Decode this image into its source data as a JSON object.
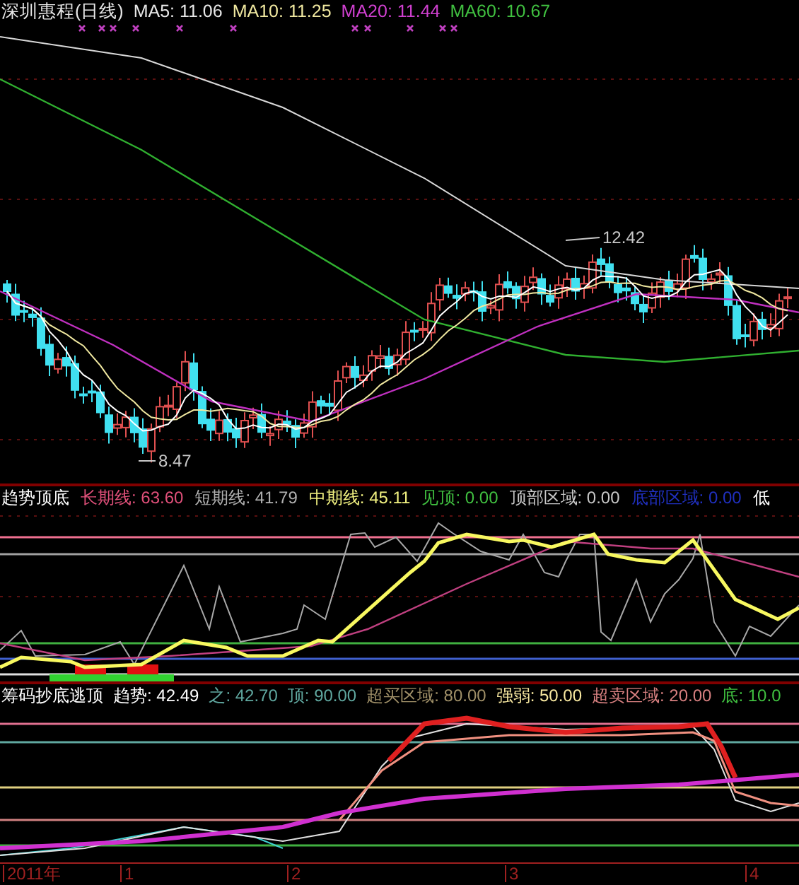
{
  "main_header": [
    {
      "text": "深圳惠程(日线)",
      "color": "#e8e8e8"
    },
    {
      "text": "MA5: 11.06",
      "color": "#e8e8e8"
    },
    {
      "text": "MA10: 11.25",
      "color": "#f0e8a0"
    },
    {
      "text": "MA20: 11.44",
      "color": "#d040d0"
    },
    {
      "text": "MA60: 10.67",
      "color": "#40c040"
    }
  ],
  "price_annotations": [
    {
      "text": "12.42",
      "kind": "high"
    },
    {
      "text": "8.47",
      "kind": "low"
    }
  ],
  "indicator_1": {
    "title": "趋势顶底",
    "items": [
      {
        "text": "长期线: 63.60",
        "color": "#e0507a"
      },
      {
        "text": "短期线: 41.79",
        "color": "#b0b0b0"
      },
      {
        "text": "中期线: 45.11",
        "color": "#f0f080"
      },
      {
        "text": "见顶: 0.00",
        "color": "#40c040"
      },
      {
        "text": "顶部区域: 0.00",
        "color": "#c8c8c8"
      },
      {
        "text": "底部区域: 0.00",
        "color": "#2030c0"
      },
      {
        "text": "低",
        "color": "#ffffff"
      }
    ]
  },
  "indicator_2": {
    "title": "筹码抄底逃顶",
    "items": [
      {
        "text": "趋势: 42.49",
        "color": "#ffffff"
      },
      {
        "text": "之: 42.70",
        "color": "#60a8a0"
      },
      {
        "text": "顶: 90.00",
        "color": "#60a8a0"
      },
      {
        "text": "超买区域: 80.00",
        "color": "#a09068"
      },
      {
        "text": "强弱: 50.00",
        "color": "#f8e8a0"
      },
      {
        "text": "超卖区域: 20.00",
        "color": "#d88080"
      },
      {
        "text": "底: 10.0",
        "color": "#40c040"
      }
    ]
  },
  "time_axis": [
    "2011年",
    "1",
    "2",
    "3",
    "4"
  ]
}
